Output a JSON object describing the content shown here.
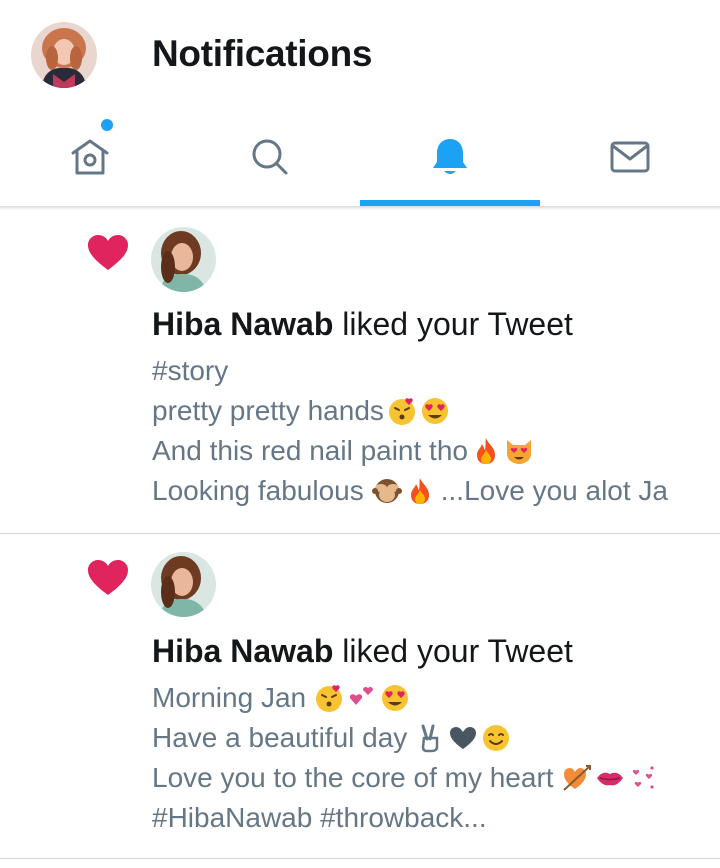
{
  "header": {
    "title": "Notifications",
    "profile_avatar": "profile-avatar"
  },
  "tabs": [
    {
      "name": "home",
      "icon": "home-icon",
      "active": false,
      "unread_dot": true
    },
    {
      "name": "search",
      "icon": "search-icon",
      "active": false
    },
    {
      "name": "notifications",
      "icon": "bell-icon",
      "active": true
    },
    {
      "name": "messages",
      "icon": "mail-icon",
      "active": false
    }
  ],
  "colors": {
    "accent": "#1da1f2",
    "like_heart": "#e0245e",
    "text_primary": "#14171a",
    "text_secondary": "#657786"
  },
  "notifications": [
    {
      "icon": "heart-icon",
      "user_name": "Hiba Nawab",
      "action": " liked your Tweet",
      "tweet_lines": [
        {
          "text": "#story",
          "emoji": []
        },
        {
          "text": "pretty pretty hands",
          "emoji": [
            "kissing-face-icon",
            "heart-eyes-face-icon"
          ]
        },
        {
          "text": "And this red nail paint tho",
          "emoji": [
            "fire-icon",
            "heart-eyes-cat-icon"
          ]
        },
        {
          "text": "Looking fabulous",
          "emoji": [
            "see-no-evil-monkey-icon",
            "fire-icon"
          ],
          "suffix": "...Love you alot Ja"
        }
      ]
    },
    {
      "icon": "heart-icon",
      "user_name": "Hiba Nawab",
      "action": " liked your Tweet",
      "tweet_lines": [
        {
          "text": "Morning Jan",
          "emoji": [
            "kissing-face-icon",
            "two-hearts-icon",
            "heart-eyes-face-icon"
          ]
        },
        {
          "text": "Have a beautiful day",
          "emoji": [
            "victory-hand-icon",
            "black-heart-icon",
            "smiling-face-icon"
          ]
        },
        {
          "text": "Love you to the core of my heart",
          "emoji": [
            "heart-with-arrow-icon",
            "kiss-lips-icon",
            "sparkle-hearts-icon"
          ]
        },
        {
          "text": "#HibaNawab #throwback...",
          "emoji": []
        }
      ]
    }
  ]
}
